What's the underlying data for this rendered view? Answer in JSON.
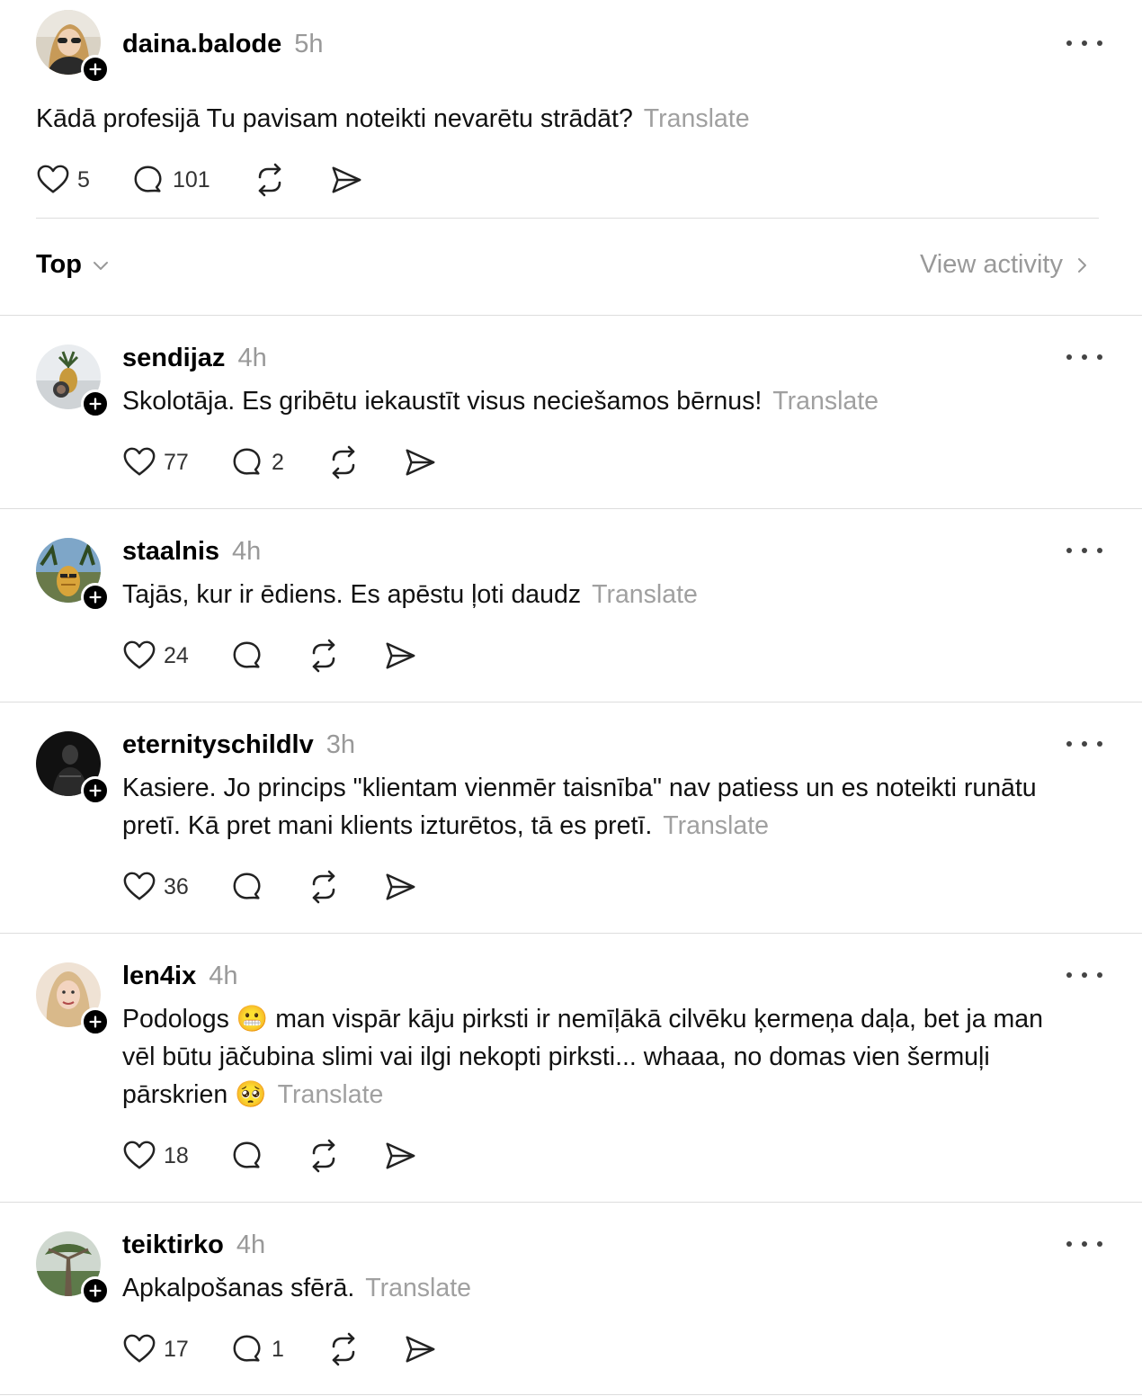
{
  "main_post": {
    "username": "daina.balode",
    "time": "5h",
    "text": "Kādā profesijā Tu pavisam noteikti nevarētu strādāt?",
    "translate_label": "Translate",
    "likes": "5",
    "replies": "101"
  },
  "sort": {
    "label": "Top",
    "view_activity": "View activity"
  },
  "replies": [
    {
      "username": "sendijaz",
      "time": "4h",
      "text": "Skolotāja. Es gribētu iekaustīt visus neciešamos bērnus!",
      "translate_label": "Translate",
      "likes": "77",
      "replies": "2"
    },
    {
      "username": "staalnis",
      "time": "4h",
      "text": "Tajās, kur ir ēdiens. Es apēstu ļoti daudz",
      "translate_label": "Translate",
      "likes": "24",
      "replies": ""
    },
    {
      "username": "eternityschildlv",
      "time": "3h",
      "text_line1": "Kasiere. Jo princips \"klientam vienmēr taisnība\" nav patiess un es noteikti runātu",
      "text_line2": "pretī. Kā pret mani klients izturētos, tā es pretī.",
      "translate_label": "Translate",
      "likes": "36",
      "replies": ""
    },
    {
      "username": "len4ix",
      "time": "4h",
      "text_a": "Podologs",
      "emoji_a": "😬",
      "text_b": "man vispār kāju pirksti ir nemīļākā cilvēku ķermeņa daļa, bet ja man",
      "text_line2": "vēl būtu jāčubina slimi vai ilgi nekopti pirksti... whaaa, no domas vien šermuļi",
      "text_line3": "pārskrien",
      "emoji_b": "🥺",
      "translate_label": "Translate",
      "likes": "18",
      "replies": ""
    },
    {
      "username": "teiktirko",
      "time": "4h",
      "text": "Apkalpošanas sfērā.",
      "translate_label": "Translate",
      "likes": "17",
      "replies": "1"
    }
  ]
}
